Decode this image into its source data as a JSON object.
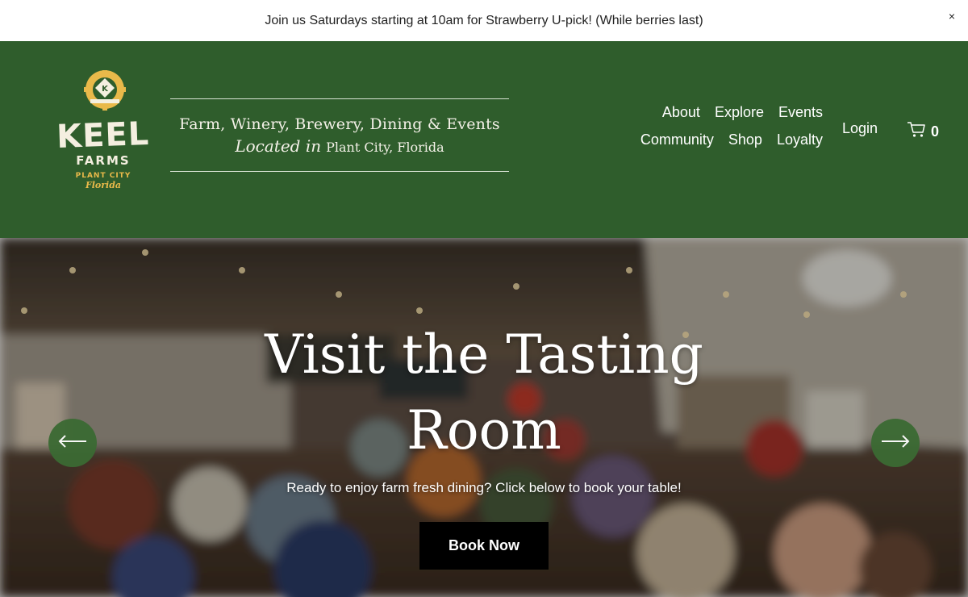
{
  "announcement": {
    "text": "Join us Saturdays starting at 10am for Strawberry U-pick! (While berries last)",
    "close": "×"
  },
  "brand": {
    "logo_word1": "KEEL",
    "logo_word2": "FARMS",
    "logo_place": "PLANT CITY",
    "logo_state": "Florida",
    "logo_badge": "K",
    "header_bg": "#2f5d2c",
    "logo_gold": "#e9b94a"
  },
  "tagline": {
    "line1": "Farm, Winery, Brewery, Dining & Events",
    "script": "Located in",
    "place": "Plant City, Florida"
  },
  "nav": {
    "row1": [
      "About",
      "Explore",
      "Events"
    ],
    "row2": [
      "Community",
      "Shop",
      "Loyalty"
    ],
    "login": "Login",
    "cart_count": "0"
  },
  "hero": {
    "title": "Visit the Tasting Room",
    "subtitle": "Ready to enjoy farm fresh dining? Click below to book your table!",
    "button": "Book Now",
    "prev_icon": "arrow-left-icon",
    "next_icon": "arrow-right-icon"
  }
}
